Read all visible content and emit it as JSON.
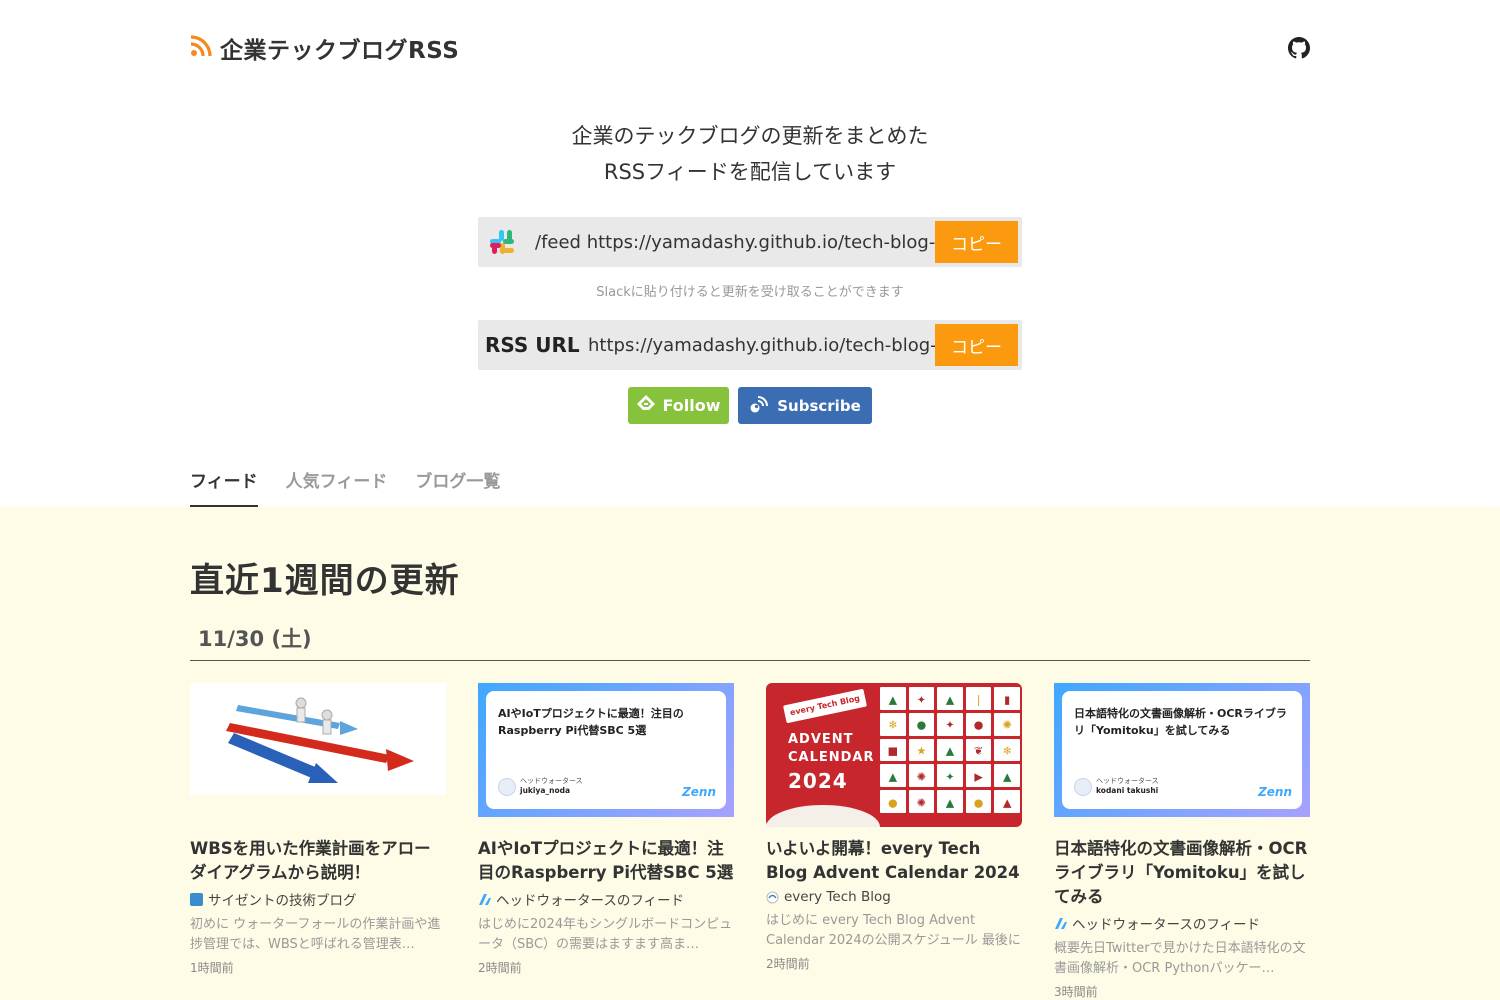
{
  "header": {
    "title": "企業テックブログRSS",
    "rss_icon": "rss-icon",
    "github_icon": "github-icon"
  },
  "tagline": {
    "line1": "企業のテックブログの更新をまとめた",
    "line2": "RSSフィードを配信しています"
  },
  "slack_box": {
    "command": "/feed https://yamadashy.github.io/tech-blog-rss-feed/feeds/rss.xml",
    "copy_label": "コピー",
    "hint": "Slackに貼り付けると更新を受け取ることができます"
  },
  "rss_box": {
    "label": "RSS URL",
    "url": "https://yamadashy.github.io/tech-blog-rss-feed/feeds/rss.xml",
    "copy_label": "コピー"
  },
  "follow_buttons": {
    "feedly_label": "Follow",
    "inoreader_label": "Subscribe"
  },
  "tabs": [
    {
      "label": "フィード",
      "active": true
    },
    {
      "label": "人気フィード",
      "active": false
    },
    {
      "label": "ブログ一覧",
      "active": false
    }
  ],
  "feed": {
    "section_title": "直近1週間の更新",
    "date_heading": "11/30 (土)",
    "cards": [
      {
        "title": "WBSを用いた作業計画をアローダイアグラムから説明！",
        "source": "サイゼントの技術ブログ",
        "excerpt": "初めに ウォーターフォールの作業計画や進捗管理では、WBSと呼ばれる管理表…",
        "time": "1時間前"
      },
      {
        "title": "AIやIoTプロジェクトに最適！注目のRaspberry Pi代替SBC 5選",
        "source": "ヘッドウォータースのフィード",
        "excerpt": "はじめに2024年もシングルボードコンピュータ（SBC）の需要はますます高ま…",
        "time": "2時間前",
        "thumb_title": "AIやIoTプロジェクトに最適！注目の Raspberry Pi代替SBC 5選",
        "thumb_org": "ヘッドウォータース",
        "thumb_author": "jukiya_noda",
        "thumb_logo": "Zenn"
      },
      {
        "title": "いよいよ開幕！every Tech Blog Advent Calendar 2024",
        "source": "every Tech Blog",
        "excerpt": "はじめに every Tech Blog Advent Calendar 2024の公開スケジュール 最後に …",
        "time": "2時間前",
        "thumb_ribbon": "every Tech Blog",
        "thumb_line1": "ADVENT",
        "thumb_line2": "CALENDAR",
        "thumb_year": "2024"
      },
      {
        "title": "日本語特化の文書画像解析・OCRライブラリ「Yomitoku」を試してみる",
        "source": "ヘッドウォータースのフィード",
        "excerpt": "概要先日Twitterで見かけた日本語特化の文書画像解析・OCR Pythonパッケー…",
        "time": "3時間前",
        "thumb_title": "日本語特化の文書画像解析・OCRライブラリ「Yomitoku」を試してみる",
        "thumb_org": "ヘッドウォータース",
        "thumb_author": "kodani takushi",
        "thumb_logo": "Zenn"
      }
    ]
  },
  "colors": {
    "accent_orange": "#fb9a0e",
    "feedly_green": "#86c23b",
    "inoreader_blue": "#3b6db2",
    "feed_bg": "#fefce6"
  }
}
